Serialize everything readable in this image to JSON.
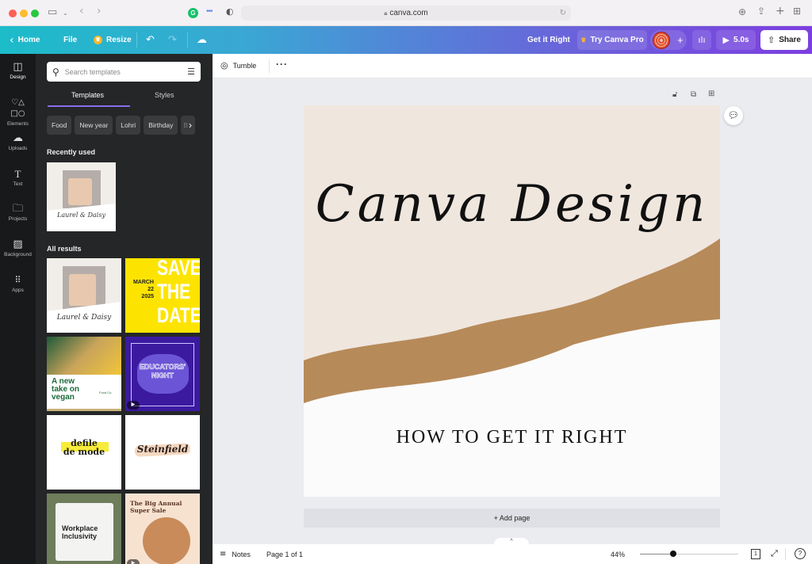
{
  "browser": {
    "url": "canva.com",
    "traffic_lights": [
      "#ff5f57",
      "#febc2e",
      "#28c840"
    ]
  },
  "topbar": {
    "home_label": "Home",
    "file_label": "File",
    "resize_label": "Resize",
    "design_title": "Get it Right",
    "try_pro_label": "Try Canva Pro",
    "play_duration": "5.0s",
    "share_label": "Share"
  },
  "rail": {
    "items": [
      {
        "label": "Design",
        "icon": "layout-icon"
      },
      {
        "label": "Elements",
        "icon": "shapes-icon"
      },
      {
        "label": "Uploads",
        "icon": "cloud-upload-icon"
      },
      {
        "label": "Text",
        "icon": "text-icon"
      },
      {
        "label": "Projects",
        "icon": "folder-icon"
      },
      {
        "label": "Background",
        "icon": "pattern-icon"
      },
      {
        "label": "Apps",
        "icon": "apps-grid-icon"
      }
    ]
  },
  "panel": {
    "search_placeholder": "Search templates",
    "tabs": [
      {
        "label": "Templates"
      },
      {
        "label": "Styles"
      }
    ],
    "chips": [
      "Food",
      "New year",
      "Lohri",
      "Birthday",
      "B"
    ],
    "recently_used_heading": "Recently used",
    "all_results_heading": "All results",
    "templates": {
      "laurel": {
        "script": "Laurel & Daisy"
      },
      "save_date": {
        "big": [
          "SAVE",
          "THE",
          "DATE"
        ],
        "date": [
          "MARCH",
          "22",
          "2025"
        ]
      },
      "vegan": {
        "lines": [
          "A new",
          "take on",
          "vegan"
        ],
        "brand": "Food Co."
      },
      "educators": {
        "line1": "EDUCATORS'",
        "line2": "NIGHT"
      },
      "defile": {
        "lines": [
          "defile",
          "de mode"
        ]
      },
      "steinfield": {
        "script": "Steinfield"
      },
      "workplace": {
        "lines": [
          "Workplace",
          "Inclusivity"
        ]
      },
      "sale": {
        "lines": [
          "The Big Annual",
          "Super Sale"
        ]
      }
    }
  },
  "context_bar": {
    "animation_label": "Tumble"
  },
  "design": {
    "title": "Canva Design",
    "subtitle": "HOW TO GET IT RIGHT",
    "colors": {
      "paper": "#efe6de",
      "kraft": "#b78a59",
      "white": "#fbfbfc"
    }
  },
  "stage": {
    "add_page_label": "+ Add page"
  },
  "footer": {
    "notes_label": "Notes",
    "page_indicator": "Page 1 of 1",
    "zoom_label": "44%",
    "zoom_value": 44,
    "page_count_badge": "1"
  }
}
